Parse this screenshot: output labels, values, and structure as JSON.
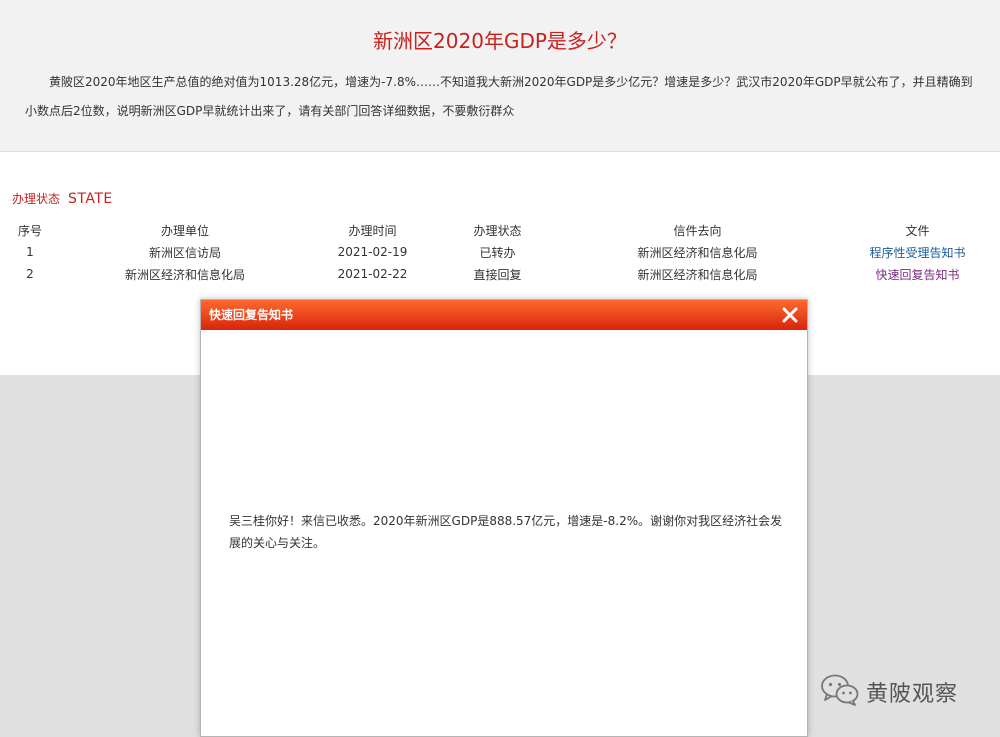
{
  "question": {
    "title": "新洲区2020年GDP是多少？",
    "body": "黄陂区2020年地区生产总值的绝对值为1013.28亿元，增速为-7.8%……不知道我大新洲2020年GDP是多少亿元？增速是多少？武汉市2020年GDP早就公布了，并且精确到小数点后2位数，说明新洲区GDP早就统计出来了，请有关部门回答详细数据，不要敷衍群众"
  },
  "status": {
    "label_cn": "办理状态",
    "label_en": "STATE",
    "columns": [
      "序号",
      "办理单位",
      "办理时间",
      "办理状态",
      "信件去向",
      "文件"
    ],
    "rows": [
      {
        "seq": "1",
        "unit": "新洲区信访局",
        "time": "2021-02-19",
        "state": "已转办",
        "dest": "新洲区经济和信息化局",
        "file": "程序性受理告知书"
      },
      {
        "seq": "2",
        "unit": "新洲区经济和信息化局",
        "time": "2021-02-22",
        "state": "直接回复",
        "dest": "新洲区经济和信息化局",
        "file": "快速回复告知书"
      }
    ]
  },
  "dialog": {
    "title": "快速回复告知书",
    "close_icon": "close-x-icon",
    "body": "吴三桂你好！来信已收悉。2020年新洲区GDP是888.57亿元，增速是-8.2%。谢谢你对我区经济社会发展的关心与关注。"
  },
  "watermark": {
    "icon": "wechat-icon",
    "text": "黄陂观察"
  },
  "colors": {
    "title_red": "#c8211e",
    "dialog_header": "#e0361a",
    "link_blue": "#1a5c9e",
    "link_purple": "#7a2a80"
  }
}
